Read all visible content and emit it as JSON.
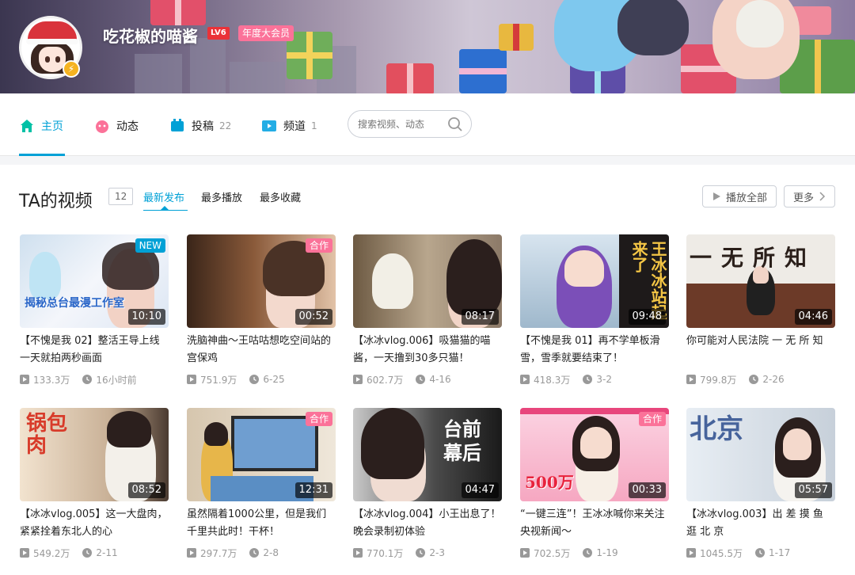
{
  "profile": {
    "name": "吃花椒的喵酱",
    "level": "LV6",
    "vip_label": "年度大会员"
  },
  "nav": {
    "items": [
      {
        "label": "主页",
        "count": "",
        "icon": "home-icon",
        "active": true
      },
      {
        "label": "动态",
        "count": "",
        "icon": "dynamic-icon",
        "active": false
      },
      {
        "label": "投稿",
        "count": "22",
        "icon": "upload-icon",
        "active": false
      },
      {
        "label": "频道",
        "count": "1",
        "icon": "channel-icon",
        "active": false
      }
    ],
    "search_placeholder": "搜索视频、动态"
  },
  "videos_section": {
    "title": "TA的视频",
    "count": "12",
    "sort_options": [
      "最新发布",
      "最多播放",
      "最多收藏"
    ],
    "play_all_label": "播放全部",
    "more_label": "更多"
  },
  "videos": [
    {
      "title": "【不愧是我 02】整活王导上线 一天就拍两秒画面",
      "duration": "10:10",
      "plays": "133.3万",
      "date": "16小时前",
      "tag": "NEW",
      "overlay": "揭秘总台最漫工作室"
    },
    {
      "title": "洗脑神曲～王咕咕想吃空间站的宫保鸡",
      "duration": "00:52",
      "plays": "751.9万",
      "date": "6-25",
      "tag": "合作",
      "overlay": ""
    },
    {
      "title": "【冰冰vlog.006】吸猫猫的喵酱，一天撸到30多只猫！",
      "duration": "08:17",
      "plays": "602.7万",
      "date": "4-16",
      "tag": "",
      "overlay": ""
    },
    {
      "title": "【不愧是我 01】再不学单板滑雪，雪季就要结束了！",
      "duration": "09:48",
      "plays": "418.3万",
      "date": "3-2",
      "tag": "",
      "overlay": "王冰冰站起来了"
    },
    {
      "title": "你可能对人民法院 一 无 所 知",
      "duration": "04:46",
      "plays": "799.8万",
      "date": "2-26",
      "tag": "",
      "overlay": "一无所知"
    },
    {
      "title": "【冰冰vlog.005】这一大盘肉，紧紧拴着东北人的心",
      "duration": "08:52",
      "plays": "549.2万",
      "date": "2-11",
      "tag": "",
      "overlay": "锅包肉"
    },
    {
      "title": "虽然隔着1000公里，但是我们千里共此时！干杯！",
      "duration": "12:31",
      "plays": "297.7万",
      "date": "2-8",
      "tag": "合作",
      "overlay": ""
    },
    {
      "title": "【冰冰vlog.004】小王出息了！晚会录制初体验",
      "duration": "04:47",
      "plays": "770.1万",
      "date": "2-3",
      "tag": "",
      "overlay": "台前幕后"
    },
    {
      "title": "“一键三连”！王冰冰喊你来关注央视新闻～",
      "duration": "00:33",
      "plays": "702.5万",
      "date": "1-19",
      "tag": "合作",
      "overlay": "500万"
    },
    {
      "title": "【冰冰vlog.003】出 差 摸 鱼 逛 北 京",
      "duration": "05:57",
      "plays": "1045.5万",
      "date": "1-17",
      "tag": "",
      "overlay": "北京"
    }
  ],
  "colors": {
    "accent": "#00a1d6",
    "pink": "#fb7299",
    "level_red": "#ea3238",
    "vip_gold": "#f5b321"
  }
}
